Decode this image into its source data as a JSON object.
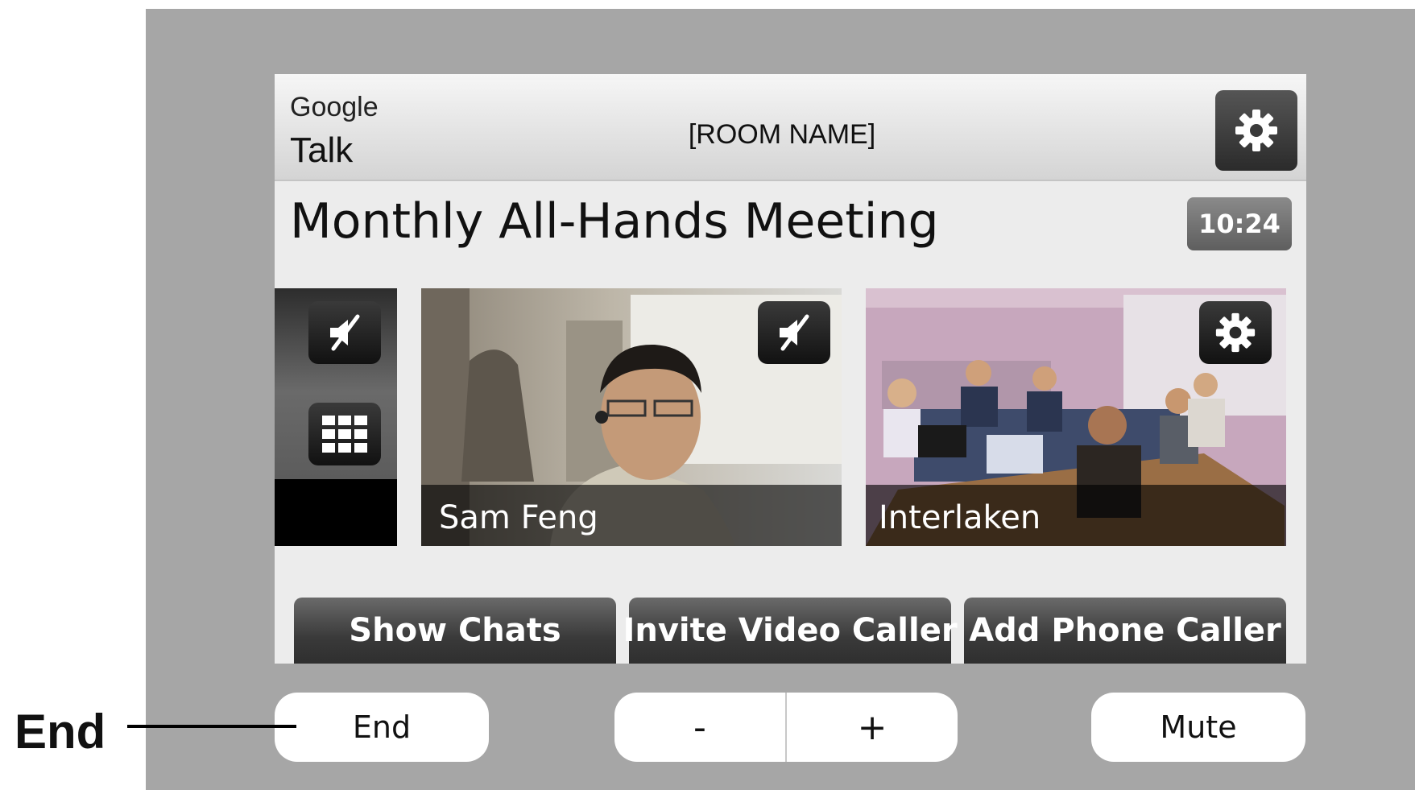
{
  "header": {
    "brand_line1": "Google",
    "brand_line2": "Talk",
    "room_name": "[ROOM NAME]",
    "settings_icon": "gear-icon"
  },
  "meeting": {
    "title": "Monthly All-Hands Meeting",
    "timer": "10:24"
  },
  "side_panel": {
    "mute_icon": "speaker-muted-icon",
    "keypad_icon": "keypad-grid-icon"
  },
  "participants": [
    {
      "name": "Sam Feng",
      "icon": "speaker-muted-icon"
    },
    {
      "name": "Interlaken",
      "icon": "gear-icon"
    }
  ],
  "actions": {
    "show_chats": "Show Chats",
    "invite_video": "Invite Video Caller",
    "add_phone": "Add Phone Caller"
  },
  "hardware": {
    "end": "End",
    "volume_down": "-",
    "volume_up": "+",
    "mute": "Mute"
  },
  "callout": {
    "label": "End"
  },
  "colors": {
    "device_bezel": "#a6a6a6",
    "screen_bg": "#ececec",
    "button_dark": "#2c2c2c"
  }
}
